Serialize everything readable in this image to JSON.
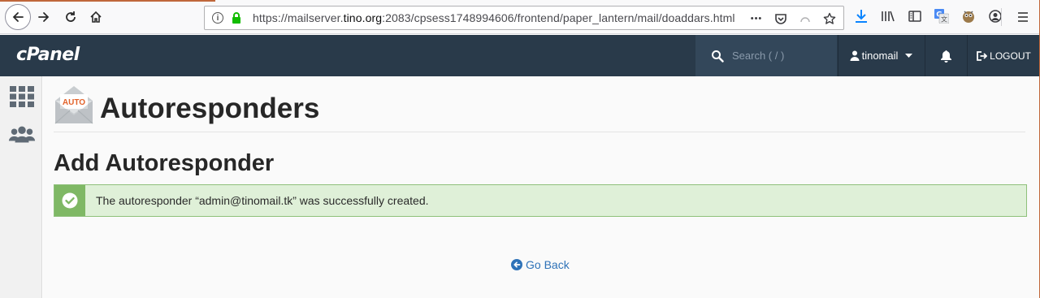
{
  "browser": {
    "url_prefix": "https://mailserver.",
    "url_host": "tino.org",
    "url_suffix": ":2083/cpsess1748994606/frontend/paper_lantern/mail/doaddars.html",
    "more_label": "•••"
  },
  "header": {
    "logo": "cPanel",
    "search_placeholder": "Search ( / )",
    "username": "tinomail",
    "logout_label": "LOGOUT"
  },
  "page": {
    "icon_badge": "AUTO",
    "title": "Autoresponders",
    "section_title": "Add Autoresponder",
    "alert_message": "The autoresponder “admin@tinomail.tk” was successfully created.",
    "go_back_label": "Go Back"
  },
  "colors": {
    "header_bg": "#293a4a",
    "success_bg": "#dff0d8",
    "success_accent": "#7fb865",
    "link": "#2e72b8"
  }
}
